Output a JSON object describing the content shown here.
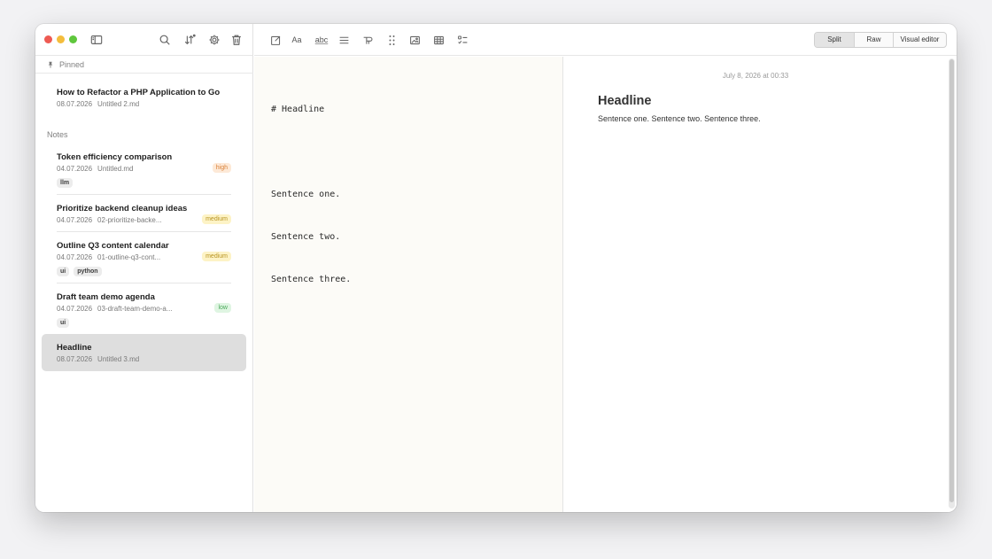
{
  "sidebar": {
    "pinned_label": "Pinned",
    "notes_label": "Notes",
    "pinned": [
      {
        "title": "How to Refactor a PHP Application to Go",
        "date": "08.07.2026",
        "file": "Untitled 2.md"
      }
    ],
    "notes": [
      {
        "title": "Token efficiency comparison",
        "date": "04.07.2026",
        "file": "Untitled.md",
        "priority": "high",
        "tags": [
          "llm"
        ]
      },
      {
        "title": "Prioritize backend cleanup ideas",
        "date": "04.07.2026",
        "file": "02-prioritize-backe...",
        "priority": "medium",
        "tags": []
      },
      {
        "title": "Outline Q3 content calendar",
        "date": "04.07.2026",
        "file": "01-outline-q3-cont...",
        "priority": "medium",
        "tags": [
          "ui",
          "python"
        ]
      },
      {
        "title": "Draft team demo agenda",
        "date": "04.07.2026",
        "file": "03-draft-team-demo-a...",
        "priority": "low",
        "tags": [
          "ui"
        ]
      },
      {
        "title": "Headline",
        "date": "08.07.2026",
        "file": "Untitled 3.md",
        "priority": "",
        "tags": []
      }
    ]
  },
  "toolbar": {
    "font_label": "Aa",
    "spell_label": "abc",
    "view_modes": [
      "Split",
      "Raw",
      "Visual editor"
    ],
    "active_mode": "Split"
  },
  "editor": {
    "lines": [
      "# Headline",
      "",
      "Sentence one.",
      "Sentence two.",
      "Sentence three."
    ]
  },
  "preview": {
    "date": "July 8, 2026 at 00:33",
    "heading": "Headline",
    "body": "Sentence one. Sentence two. Sentence three."
  },
  "colors": {
    "priority_high_bg": "#fde9d7",
    "priority_high_fg": "#d9823b",
    "priority_medium_bg": "#fdf3c6",
    "priority_medium_fg": "#b99422",
    "priority_low_bg": "#dff5e2",
    "priority_low_fg": "#4caa5c",
    "selected_bg": "#dedede",
    "editor_bg": "#fcfbf7"
  }
}
